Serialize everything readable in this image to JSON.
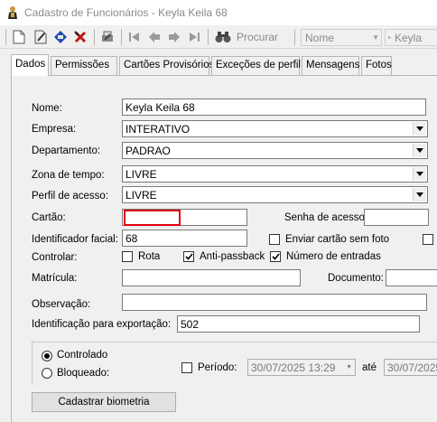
{
  "window": {
    "title": "Cadastro de Funcionários - Keyla Keila 68"
  },
  "toolbar": {
    "search_label": "Procurar",
    "field_combo": "Nome",
    "value_combo": "Keyla"
  },
  "tabs": [
    "Dados",
    "Permissões",
    "Cartões Provisórios",
    "Exceções de perfil",
    "Mensagens",
    "Fotos"
  ],
  "form": {
    "nome_label": "Nome:",
    "nome_value": "Keyla Keila 68",
    "empresa_label": "Empresa:",
    "empresa_value": "INTERATIVO",
    "departamento_label": "Departamento:",
    "departamento_value": "PADRAO",
    "zona_label": "Zona de tempo:",
    "zona_value": "LIVRE",
    "perfil_label": "Perfil de acesso:",
    "perfil_value": "LIVRE",
    "cartao_label": "Cartão:",
    "cartao_value": "",
    "senha_label": "Senha de acesso:",
    "senha_value": "",
    "facial_label": "Identificador facial:",
    "facial_value": "68",
    "enviar_cartao_label": "Enviar cartão sem foto",
    "controlar_label": "Controlar:",
    "rota_label": "Rota",
    "antipassback_label": "Anti-passback",
    "num_entradas_label": "Número de entradas",
    "matricula_label": "Matrícula:",
    "matricula_value": "",
    "documento_label": "Documento:",
    "documento_value": "",
    "observacao_label": "Observação:",
    "observacao_value": "",
    "export_label": "Identificação para exportação:",
    "export_value": "502",
    "controlado_label": "Controlado",
    "bloqueado_label": "Bloqueado:",
    "periodo_label": "Período:",
    "periodo_inicio": "30/07/2025 13:29",
    "ate_label": "até",
    "periodo_fim": "30/07/2025",
    "biometria_button": "Cadastrar biometria"
  },
  "colors": {
    "highlight": "#e0000a",
    "window_bg": "#f0f0f0"
  }
}
